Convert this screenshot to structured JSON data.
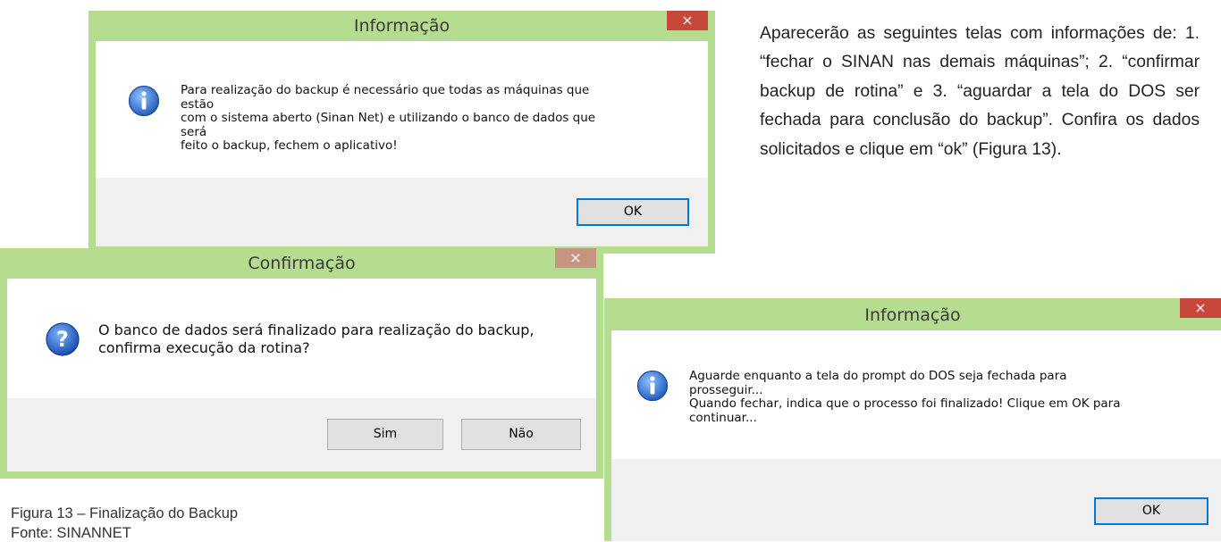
{
  "dialog_info_1": {
    "title": "Informação",
    "close_glyph": "×",
    "icon": "info-icon",
    "message": "Para realização do backup é necessário que todas as máquinas que\nestão\ncom o sistema aberto (Sinan Net) e utilizando o banco de dados que\nserá\nfeito o backup, fechem o aplicativo!",
    "ok_label": "OK"
  },
  "dialog_confirm": {
    "title": "Confirmação",
    "close_glyph": "×",
    "icon": "question-icon",
    "message": "O banco de dados será finalizado para realização do backup,\nconfirma execução da rotina?",
    "yes_label": "Sim",
    "no_label": "Não"
  },
  "dialog_info_2": {
    "title": "Informação",
    "close_glyph": "×",
    "icon": "info-icon",
    "message": "Aguarde enquanto a tela do prompt do DOS seja fechada para\nprosseguir...\nQuando fechar, indica que o processo foi finalizado! Clique em OK para\ncontinuar...",
    "ok_label": "OK"
  },
  "document": {
    "paragraph": "Aparecerão as seguintes telas com informações de: 1. “fechar o SINAN nas demais máquinas”; 2. “confirmar backup de rotina” e 3. “aguardar a tela do DOS ser fechada para conclusão do backup”. Confira os dados solicitados e clique em “ok” (Figura 13).",
    "caption_figure": "Figura 13 – Finalização do Backup",
    "caption_source": "Fonte: SINANNET"
  },
  "colors": {
    "titlebar": "#b6dc8f",
    "close_active": "#c7473b",
    "close_inactive": "#c69481",
    "footer": "#f0f0f0",
    "info_icon": "#2f6fc9",
    "question_icon": "#1f5fbf"
  }
}
